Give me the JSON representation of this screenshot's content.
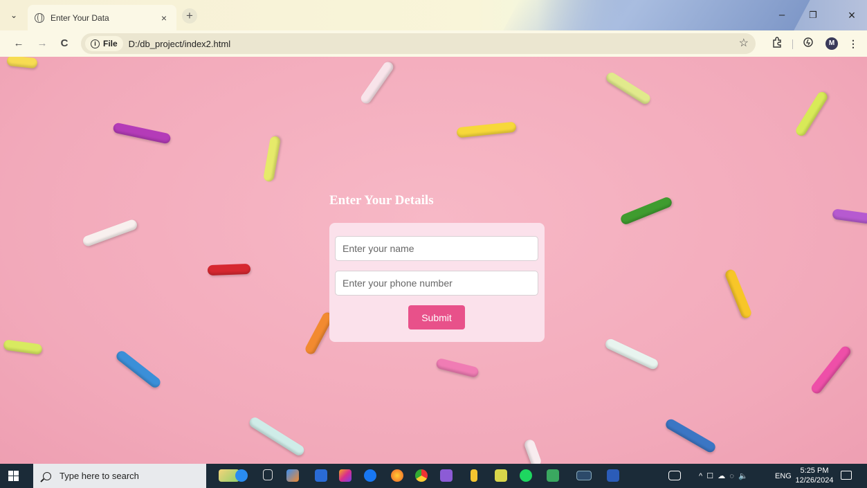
{
  "browser": {
    "tab_title": "Enter Your Data",
    "tab_close": "×",
    "new_tab": "+",
    "nav": {
      "back": "←",
      "forward": "→",
      "reload": "C"
    },
    "security_chip": "File",
    "url": "D:/db_project/index2.html",
    "bookmark_star": "☆",
    "profile_initial": "M",
    "window": {
      "minimize": "–",
      "restore": "❐",
      "close": "×"
    }
  },
  "form": {
    "heading": "Enter Your Details",
    "name_placeholder": "Enter your name",
    "phone_placeholder": "Enter your phone number",
    "submit_label": "Submit"
  },
  "taskbar": {
    "search_placeholder": "Type here to search",
    "language": "ENG",
    "time": "5:25 PM",
    "date": "12/26/2024"
  },
  "colors": {
    "background_pink": "#f4b3c2",
    "card": "#fbe1eb",
    "submit_button": "#e8518a"
  },
  "icons": [
    "chevron-down-icon",
    "globe-icon",
    "close-icon",
    "plus-icon",
    "back-arrow-icon",
    "forward-arrow-icon",
    "reload-icon",
    "info-icon",
    "star-icon",
    "extensions-icon",
    "performance-icon",
    "more-icon",
    "windows-start-icon",
    "search-icon",
    "notification-icon"
  ]
}
